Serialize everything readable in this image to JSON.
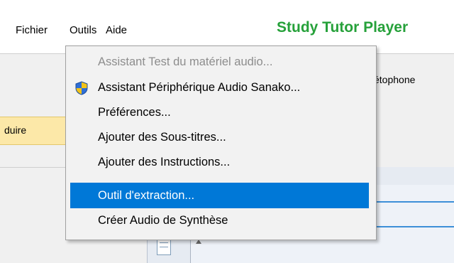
{
  "menubar": {
    "file": "Fichier",
    "tools": "Outils",
    "help": "Aide"
  },
  "app_title": "Study Tutor Player",
  "background": {
    "tab_partial": "duire",
    "right_text_partial": "étophone"
  },
  "dropdown": {
    "items": [
      {
        "label": "Assistant Test du matériel audio...",
        "state": "disabled"
      },
      {
        "label": "Assistant Périphérique Audio Sanako...",
        "icon": "uac-shield-icon"
      },
      {
        "label": "Préférences..."
      },
      {
        "label": "Ajouter des Sous-titres..."
      },
      {
        "label": "Ajouter des Instructions..."
      },
      {
        "label": "Outil d'extraction...",
        "state": "highlighted"
      },
      {
        "label": "Créer Audio de Synthèse"
      }
    ]
  },
  "colors": {
    "title_green": "#26a13a",
    "highlight_blue": "#0078d7",
    "tab_orange": "#fce8a8"
  }
}
